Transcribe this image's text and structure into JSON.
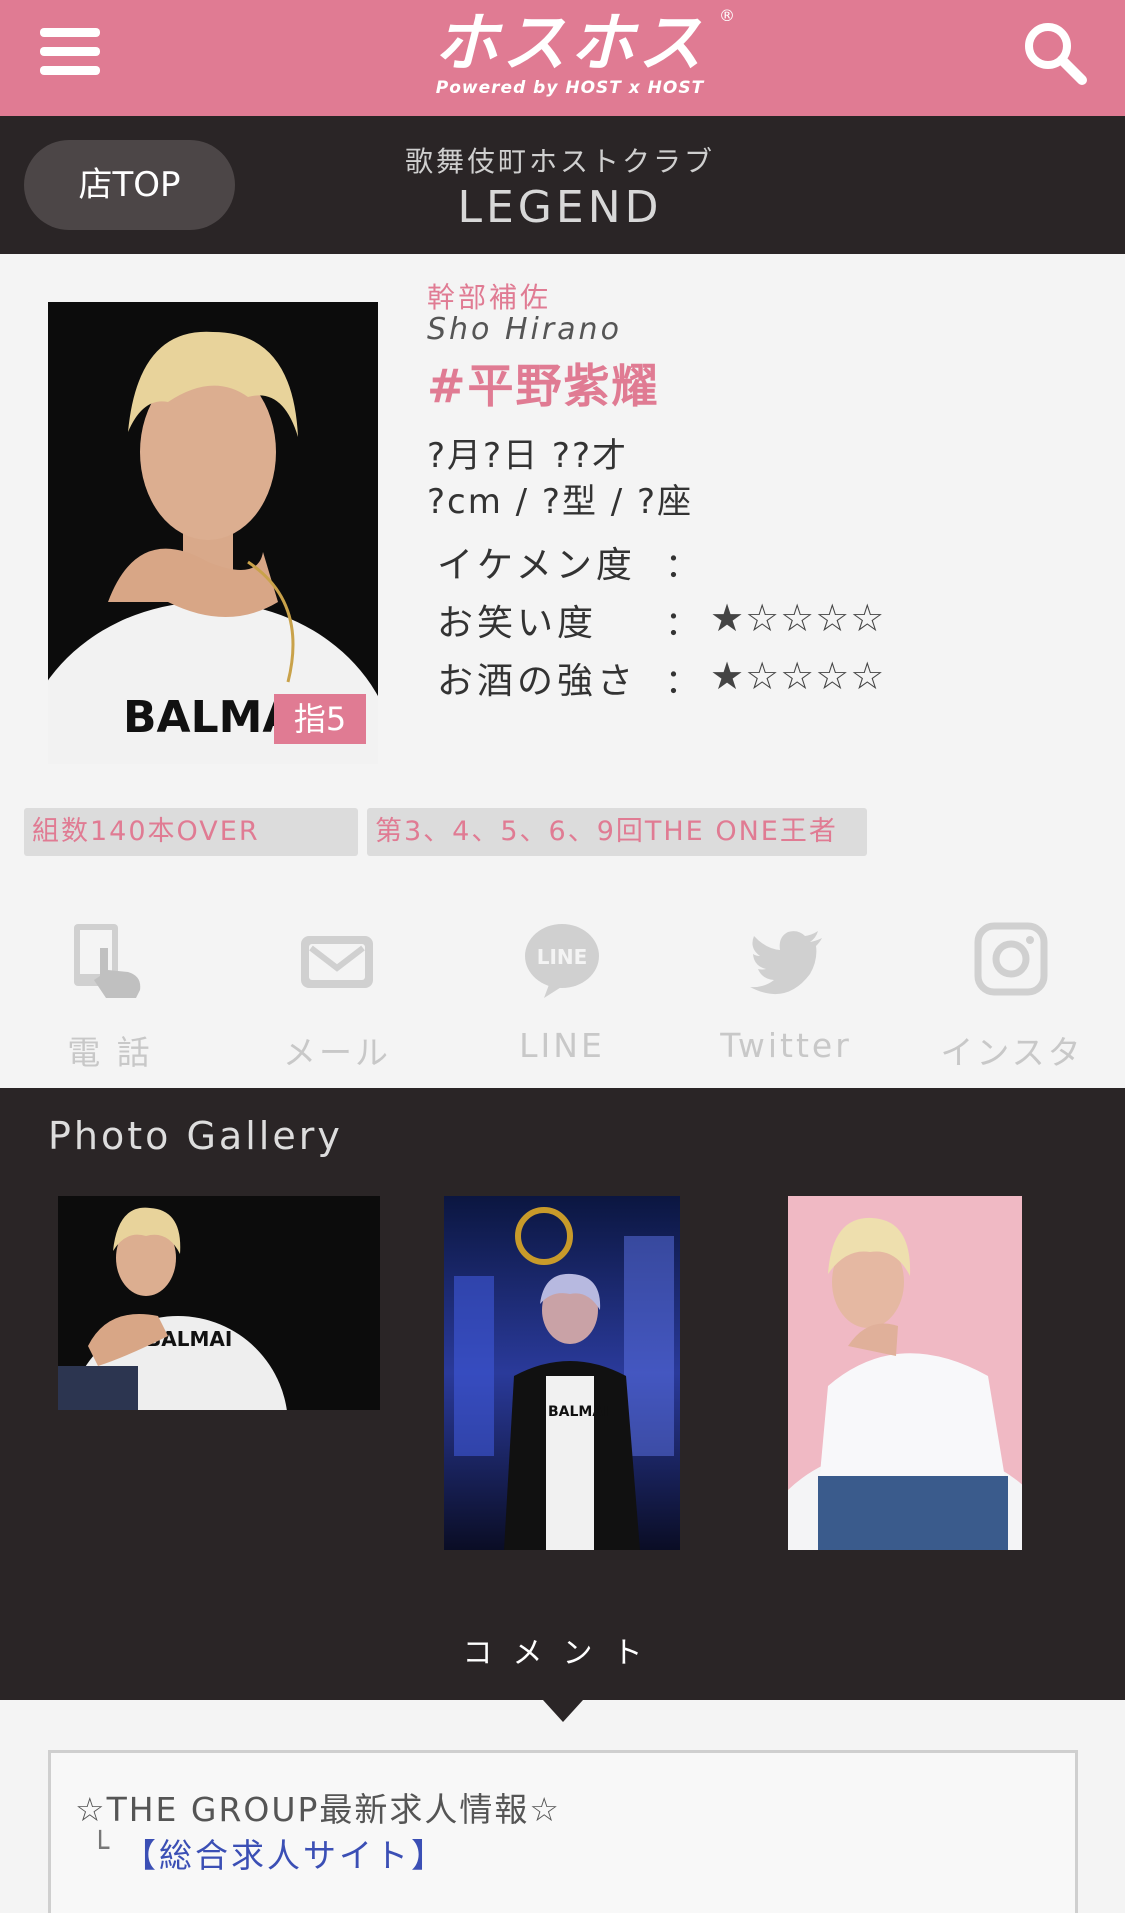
{
  "header": {
    "logo_main": "ホスホス",
    "logo_sub": "Powered by HOST x HOST",
    "logo_reg": "®"
  },
  "shopbar": {
    "top_button": "店TOP",
    "subtitle": "歌舞伎町ホストクラブ",
    "shop_name": "LEGEND"
  },
  "profile": {
    "rank_badge": "指5",
    "role": "幹部補佐",
    "romaji": "Sho Hirano",
    "name": "#平野紫耀",
    "birth": "?月?日 ??才",
    "body": "?cm / ?型 / ?座",
    "stats": [
      {
        "label": "イケメン度",
        "colon": "：",
        "stars": ""
      },
      {
        "label": "お笑い度",
        "colon": "：",
        "stars": "★☆☆☆☆"
      },
      {
        "label": "お酒の強さ",
        "colon": "：",
        "stars": "★☆☆☆☆"
      }
    ]
  },
  "tags": [
    "組数140本OVER",
    "第3、4、5、6、9回THE ONE王者"
  ],
  "contacts": [
    {
      "label": "電 話",
      "icon": "phone-icon"
    },
    {
      "label": "メール",
      "icon": "mail-icon"
    },
    {
      "label": "LINE",
      "icon": "line-icon",
      "icon_text": "LINE"
    },
    {
      "label": "Twitter",
      "icon": "twitter-icon"
    },
    {
      "label": "インスタ",
      "icon": "instagram-icon"
    }
  ],
  "gallery": {
    "title": "Photo Gallery",
    "comment_title": "コメント"
  },
  "comment": {
    "line1": "☆THE GROUP最新求人情報☆",
    "line2_prefix": "└",
    "line2": "【総合求人サイト】"
  },
  "colors": {
    "accent_pink": "#e07b93",
    "dark_bg": "#2a2526",
    "link_blue": "#3b4fb5"
  }
}
